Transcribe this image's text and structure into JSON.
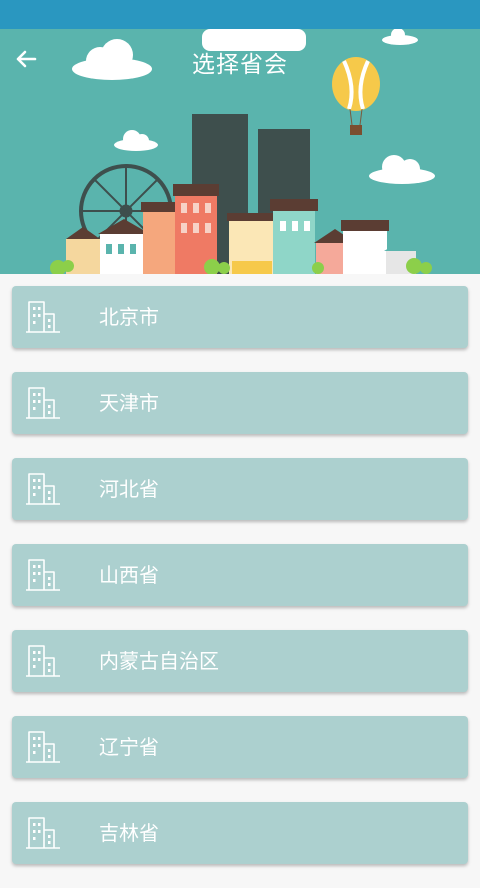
{
  "header": {
    "title": "选择省会"
  },
  "colors": {
    "status_bar": "#2a97c0",
    "header_bg": "#5ab4ad",
    "item_bg": "#acd0cf",
    "text": "#ffffff"
  },
  "icons": {
    "back": "arrow-left-icon",
    "item": "building-icon"
  },
  "provinces": [
    {
      "label": "北京市"
    },
    {
      "label": "天津市"
    },
    {
      "label": "河北省"
    },
    {
      "label": "山西省"
    },
    {
      "label": "内蒙古自治区"
    },
    {
      "label": "辽宁省"
    },
    {
      "label": "吉林省"
    }
  ]
}
